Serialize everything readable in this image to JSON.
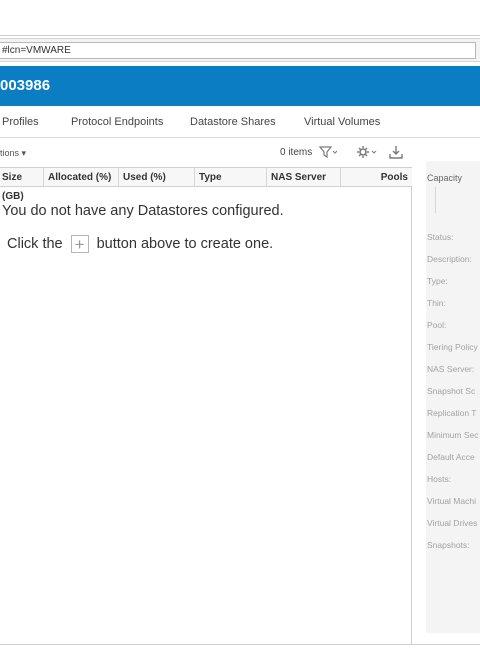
{
  "address": {
    "url": "#lcn=VMWARE"
  },
  "banner": {
    "title": "003986"
  },
  "tabs": [
    {
      "label": "Profiles"
    },
    {
      "label": "Protocol Endpoints"
    },
    {
      "label": "Datastore Shares"
    },
    {
      "label": "Virtual Volumes"
    }
  ],
  "toolbar": {
    "more_actions": "tions ▾",
    "items_count": "0 items"
  },
  "columns": [
    {
      "label": "Size (GB)"
    },
    {
      "label": "Allocated (%)"
    },
    {
      "label": "Used (%)"
    },
    {
      "label": "Type"
    },
    {
      "label": "NAS Server"
    },
    {
      "label": "Pools"
    }
  ],
  "empty_state": {
    "line1": "You do not have any Datastores configured.",
    "line2_prefix": "Click the",
    "plus_symbol": "+",
    "line2_suffix": "button above to create one."
  },
  "properties": {
    "capacity_label": "Capacity",
    "fields": [
      "Status:",
      "Description:",
      "Type:",
      "Thin:",
      "Pool:",
      "Tiering Policy",
      "NAS Server:",
      "Snapshot Sc",
      "Replication T",
      "Minimum Sec",
      "Default Acce",
      "Hosts:",
      "Virtual Machi",
      "Virtual Drives",
      "Snapshots:"
    ]
  },
  "colors": {
    "banner": "#0b7dc2",
    "accent": "#0b7dc2"
  },
  "icons": [
    "filter-icon",
    "gear-icon",
    "export-icon",
    "plus-icon"
  ]
}
